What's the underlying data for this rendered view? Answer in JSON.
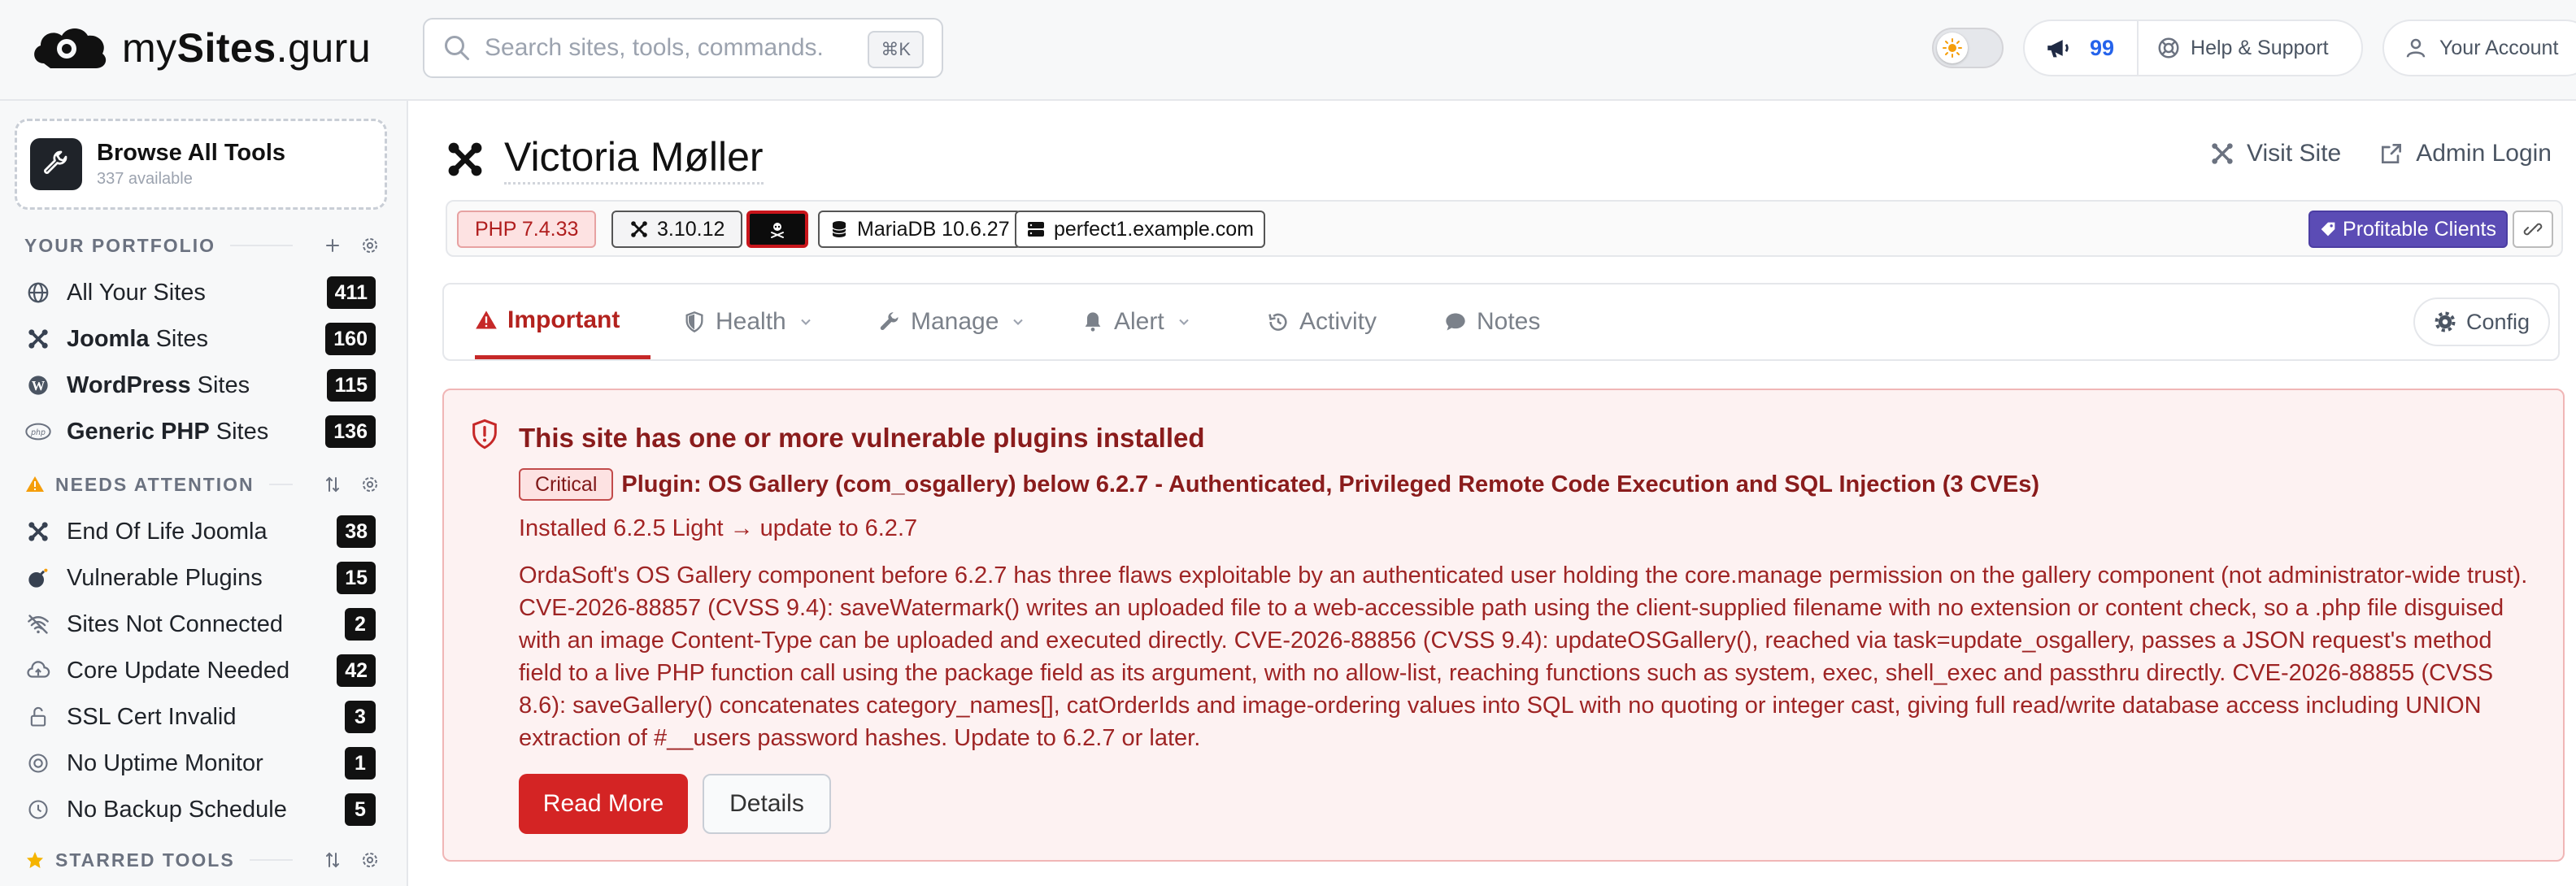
{
  "brand": {
    "name_prefix": "my",
    "name_bold": "Sites",
    "name_suffix": ".guru"
  },
  "search": {
    "placeholder": "Search sites, tools, commands.",
    "shortcut": "⌘K"
  },
  "header": {
    "theme_toggle_state": "light",
    "notifications_count": "99",
    "help_label": "Help & Support",
    "account_label": "Your Account"
  },
  "sidebar": {
    "browse": {
      "title": "Browse All Tools",
      "subtitle": "337 available"
    },
    "portfolio": {
      "heading": "YOUR PORTFOLIO",
      "items": [
        {
          "label": "All Your Sites",
          "bold": "",
          "count": "411",
          "icon": "globe-icon"
        },
        {
          "label": " Sites",
          "bold": "Joomla",
          "count": "160",
          "icon": "joomla-icon"
        },
        {
          "label": " Sites",
          "bold": "WordPress",
          "count": "115",
          "icon": "wordpress-icon"
        },
        {
          "label": " Sites",
          "bold": "Generic PHP",
          "count": "136",
          "icon": "php-icon"
        }
      ]
    },
    "attention": {
      "heading": "NEEDS ATTENTION",
      "items": [
        {
          "label": "End Of Life Joomla",
          "count": "38",
          "icon": "joomla-icon"
        },
        {
          "label": "Vulnerable Plugins",
          "count": "15",
          "icon": "bomb-icon"
        },
        {
          "label": "Sites Not Connected",
          "count": "2",
          "icon": "wifi-off-icon"
        },
        {
          "label": "Core Update Needed",
          "count": "42",
          "icon": "cloud-upload-icon"
        },
        {
          "label": "SSL Cert Invalid",
          "count": "3",
          "icon": "unlock-icon"
        },
        {
          "label": "No Uptime Monitor",
          "count": "1",
          "icon": "target-icon"
        },
        {
          "label": "No Backup Schedule",
          "count": "5",
          "icon": "clock-icon"
        }
      ]
    },
    "starred": {
      "heading": "STARRED TOOLS"
    }
  },
  "site": {
    "title": "Victoria Møller",
    "visit_label": "Visit Site",
    "admin_label": "Admin Login",
    "chips": {
      "php": "PHP 7.4.33",
      "joomla": "3.10.12",
      "db": "MariaDB 10.6.27",
      "host": "perfect1.example.com",
      "tag": "Profitable Clients"
    }
  },
  "tabs": [
    {
      "label": "Important",
      "icon": "warning-icon",
      "active": true
    },
    {
      "label": "Health",
      "icon": "shield-icon"
    },
    {
      "label": "Manage",
      "icon": "wrench-icon"
    },
    {
      "label": "Alert",
      "icon": "bell-icon"
    },
    {
      "label": "Activity",
      "icon": "history-icon"
    },
    {
      "label": "Notes",
      "icon": "comment-icon"
    }
  ],
  "config_label": "Config",
  "alert": {
    "title": "This site has one or more vulnerable plugins installed",
    "severity": "Critical",
    "plugin_title": "Plugin: OS Gallery (com_osgallery) below 6.2.7 - Authenticated, Privileged Remote Code Execution and SQL Injection (3 CVEs)",
    "installed": "Installed 6.2.5 Light → update to 6.2.7",
    "description": "OrdaSoft's OS Gallery component before 6.2.7 has three flaws exploitable by an authenticated user holding the core.manage permission on the gallery component (not administrator-wide trust). CVE-2026-88857 (CVSS 9.4): saveWatermark() writes an uploaded file to a web-accessible path using the client-supplied filename with no extension or content check, so a .php file disguised with an image Content-Type can be uploaded and executed directly. CVE-2026-88856 (CVSS 9.4): updateOSGallery(), reached via task=update_osgallery, passes a JSON request's method field to a live PHP function call using the package field as its argument, with no allow-list, reaching functions such as system, exec, shell_exec and passthru directly. CVE-2026-88855 (CVSS 8.6): saveGallery() concatenates category_names[], catOrderIds and image-ordering values into SQL with no quoting or integer cast, giving full read/write database access including UNION extraction of #__users password hashes. Update to 6.2.7 or later.",
    "read_more": "Read More",
    "details": "Details"
  },
  "colors": {
    "accent_red": "#c62828",
    "badge_bg": "#111111",
    "tag_purple": "#5b4cb5",
    "notif_blue": "#2563eb"
  }
}
